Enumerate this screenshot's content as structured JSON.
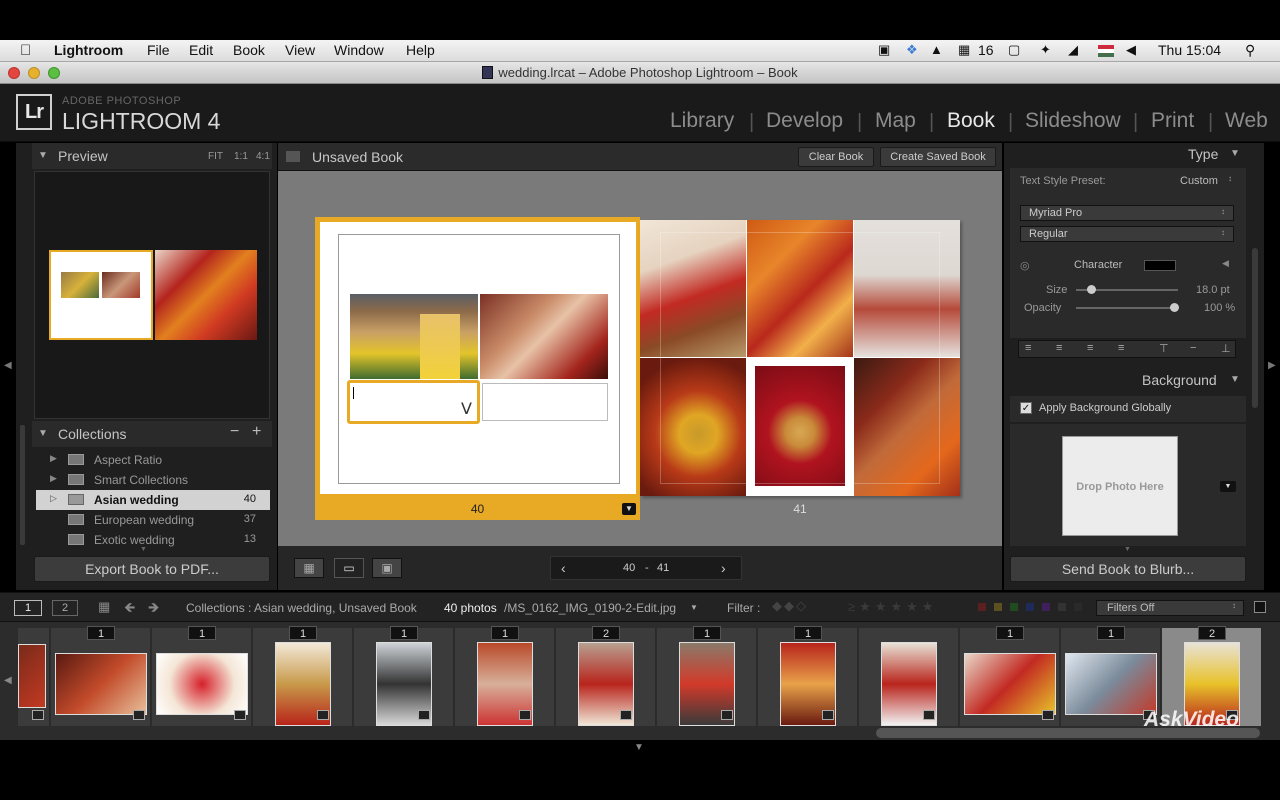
{
  "menubar": {
    "apple": "",
    "app": "Lightroom",
    "items": [
      "File",
      "Edit",
      "Book",
      "View",
      "Window",
      "Help"
    ],
    "adobe_count": "16",
    "time": "Thu 15:04"
  },
  "window": {
    "title": "wedding.lrcat – Adobe Photoshop Lightroom – Book"
  },
  "brand": {
    "lr": "Lr",
    "line1": "ADOBE PHOTOSHOP",
    "line2": "LIGHTROOM 4"
  },
  "modules": {
    "library": "Library",
    "develop": "Develop",
    "map": "Map",
    "book": "Book",
    "slideshow": "Slideshow",
    "print": "Print",
    "web": "Web",
    "separator": "|"
  },
  "left": {
    "preview_title": "Preview",
    "zoom": {
      "fit": "FIT",
      "one": "1:1",
      "four": "4:1"
    },
    "collections_title": "Collections",
    "collections": [
      {
        "name": "Aspect Ratio",
        "count": ""
      },
      {
        "name": "Smart Collections",
        "count": ""
      },
      {
        "name": "Asian wedding",
        "count": "40"
      },
      {
        "name": "European wedding",
        "count": "37"
      },
      {
        "name": "Exotic wedding",
        "count": "13"
      }
    ],
    "export_label": "Export Book to PDF..."
  },
  "center": {
    "book_title": "Unsaved Book",
    "clear_label": "Clear Book",
    "create_label": "Create Saved Book",
    "left_page_num": "40",
    "right_page_num": "41",
    "pager": {
      "from": "40",
      "dash": "-",
      "to": "41"
    }
  },
  "right": {
    "type_title": "Type",
    "preset_label": "Text Style Preset:",
    "preset_value": "Custom",
    "font": "Myriad Pro",
    "style": "Regular",
    "character_label": "Character",
    "size_label": "Size",
    "size_value": "18.0 pt",
    "size_level": 0.15,
    "opacity_label": "Opacity",
    "opacity_value": "100 %",
    "opacity_level": 1.0,
    "background_title": "Background",
    "apply_bg_label": "Apply Background Globally",
    "drop_label": "Drop Photo Here",
    "send_label": "Send Book to Blurb..."
  },
  "filmstrip_bar": {
    "view1": "1",
    "view2": "2",
    "source": "Collections : Asian wedding, Unsaved Book",
    "count": "40 photos",
    "file": "/MS_0162_IMG_0190-2-Edit.jpg",
    "filter_label": "Filter :",
    "filters_off": "Filters Off"
  },
  "filmstrip": {
    "counts": [
      "1",
      "1",
      "1",
      "1",
      "1",
      "2",
      "1",
      "1",
      "",
      "1",
      "1",
      "2"
    ]
  },
  "watermark": "AskVideo",
  "colors": {
    "accent": "#e8a925",
    "panel": "#262626",
    "canvas": "#7a7a7a"
  }
}
